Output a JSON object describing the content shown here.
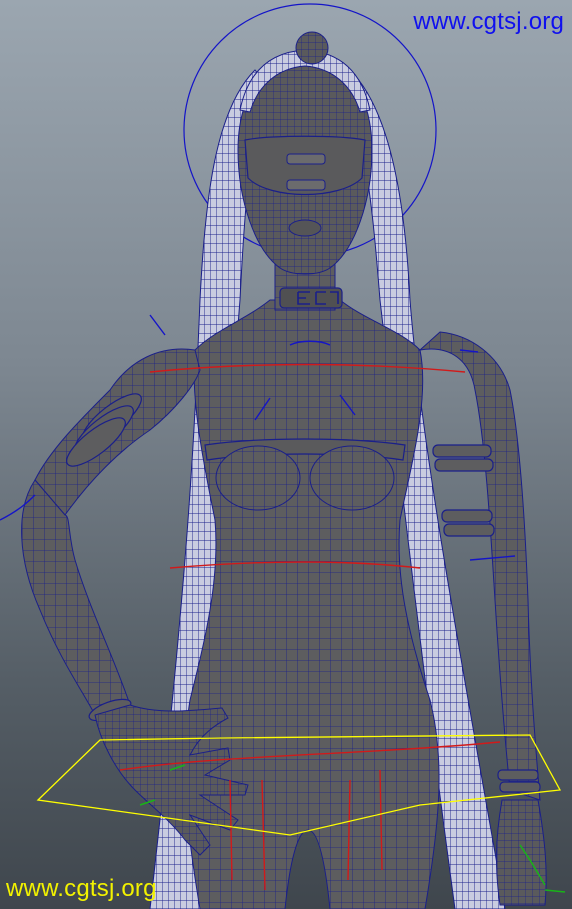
{
  "viewport": {
    "background_top": "#9ba6b0",
    "background_bottom": "#3f464d"
  },
  "model": {
    "surface_color": "#5d5d5f",
    "wire_color": "#1a1f8a",
    "hair_color": "#c9cce0",
    "curve_color": "#1414c8",
    "red_curve_color": "#d11a1a",
    "selection_color": "#ffff00",
    "control_color": "#18b418"
  },
  "watermarks": {
    "top": {
      "text": "www.cgtsj.org",
      "color": "#1010ee"
    },
    "bottom": {
      "text": "www.cgtsj.org",
      "color": "#f2f200"
    }
  }
}
